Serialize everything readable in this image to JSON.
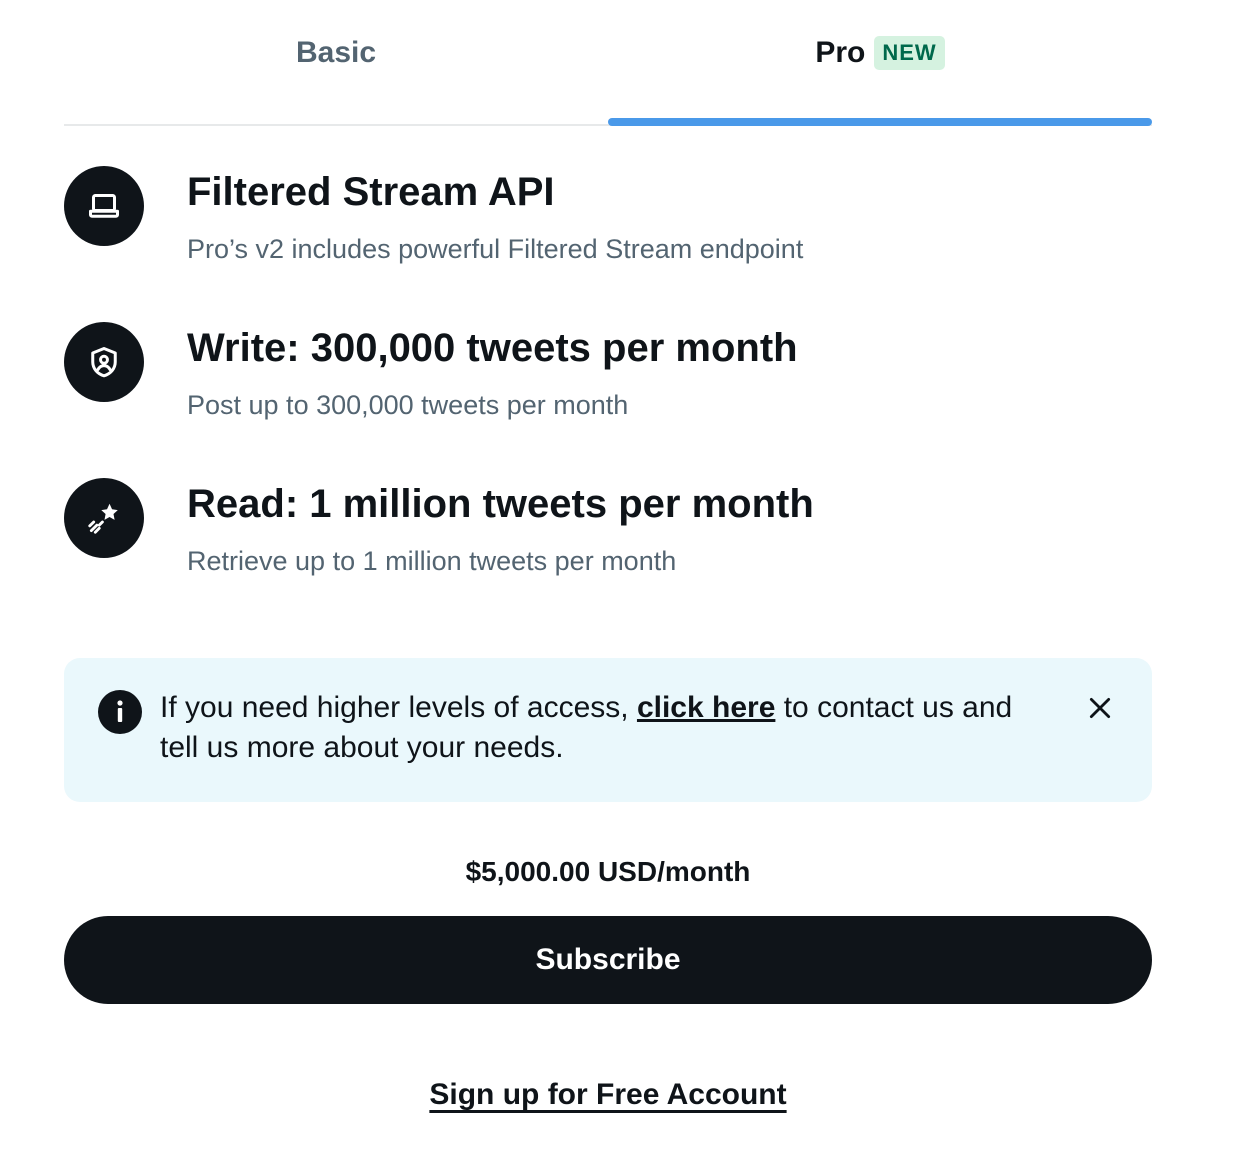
{
  "tabs": [
    {
      "label": "Basic",
      "active": false
    },
    {
      "label": "Pro",
      "badge": "NEW",
      "active": true
    }
  ],
  "features": [
    {
      "icon": "laptop-icon",
      "title": "Filtered Stream API",
      "description": "Pro’s v2 includes powerful Filtered Stream endpoint"
    },
    {
      "icon": "shield-user-icon",
      "title": "Write: 300,000 tweets per month",
      "description": "Post up to 300,000 tweets per month"
    },
    {
      "icon": "shooting-star-icon",
      "title": "Read: 1 million tweets per month",
      "description": "Retrieve up to 1 million tweets per month"
    }
  ],
  "banner": {
    "text_before": "If you need higher levels of access, ",
    "link": "click here",
    "text_after": " to contact us and tell us more about your needs."
  },
  "pricing": {
    "price": "$5,000.00 USD/month",
    "subscribe_label": "Subscribe",
    "signup_label": "Sign up for Free Account"
  },
  "colors": {
    "accent": "#4a99e9",
    "dark": "#0f1419",
    "muted": "#536471",
    "badge_bg": "#d5f2e0",
    "badge_text": "#00694c",
    "banner_bg": "#eaf8fc"
  }
}
